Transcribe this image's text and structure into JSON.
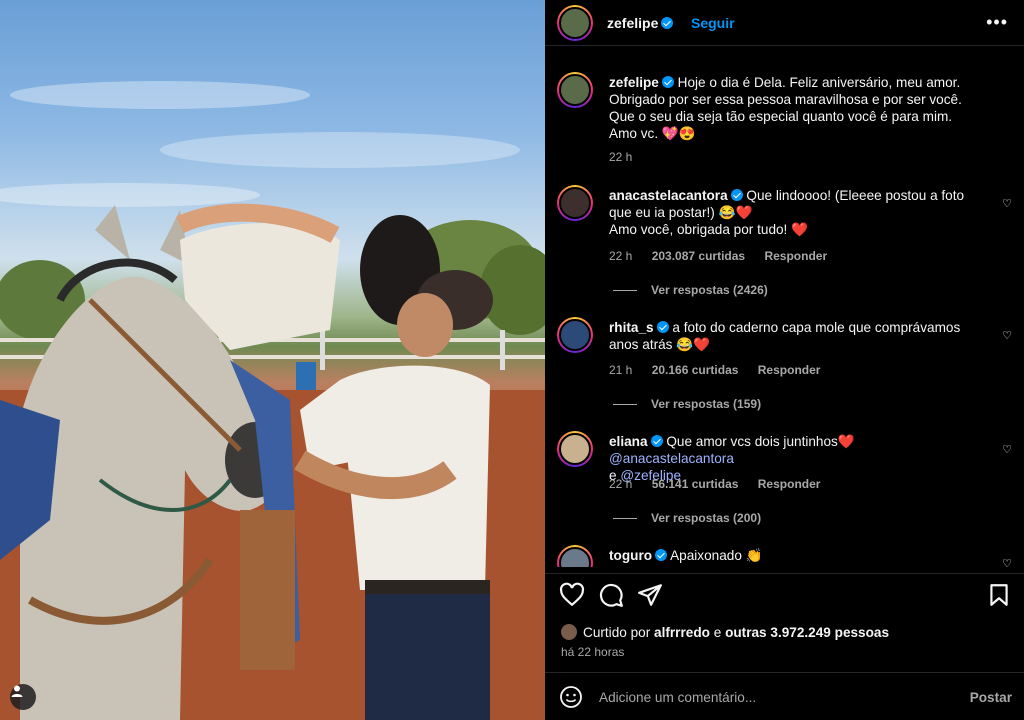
{
  "post": {
    "author": "zefelipe",
    "follow_label": "Seguir",
    "more_label": "•••"
  },
  "caption": {
    "username": "zefelipe",
    "text": "Hoje o dia é Dela. Feliz aniversário, meu amor. Obrigado por ser essa pessoa maravilhosa e por ser você. Que o seu dia seja tão especial quanto você é para mim.",
    "text2": "Amo vc. 💖😍",
    "time": "22 h"
  },
  "comments": [
    {
      "username": "anacastelacantora",
      "verified": true,
      "text": "Que lindoooo! (Eleeee postou a foto que eu ia postar!) 😂❤️",
      "text2": "Amo você, obrigada por tudo! ❤️",
      "time": "22 h",
      "likes": "203.087 curtidas",
      "reply_label": "Responder",
      "view_replies": "Ver respostas (2426)"
    },
    {
      "username": "rhita_s",
      "verified": true,
      "text": "a foto do caderno capa mole que comprávamos anos atrás 😂❤️",
      "time": "21 h",
      "likes": "20.166 curtidas",
      "reply_label": "Responder",
      "view_replies": "Ver respostas (159)"
    },
    {
      "username": "eliana",
      "verified": true,
      "text": "Que amor vcs dois juntinhos❤️",
      "mention1": "@anacastelacantora",
      "conj": "e",
      "mention2": "@zefelipe",
      "time": "22 h",
      "likes": "56.141 curtidas",
      "reply_label": "Responder",
      "view_replies": "Ver respostas (200)"
    },
    {
      "username": "toguro",
      "verified": true,
      "text": "Apaixonado 👏"
    }
  ],
  "likes_line": {
    "prefix": "Curtido por",
    "user": "alfrrredo",
    "conj": "e",
    "others": "outras 3.972.249 pessoas"
  },
  "posted_ago": "há 22 horas",
  "add_comment": {
    "placeholder": "Adicione um comentário...",
    "post_label": "Postar"
  },
  "icons": [
    "heart-icon",
    "comment-icon",
    "share-icon",
    "bookmark-icon",
    "emoji-icon",
    "user-icon",
    "verified-icon"
  ],
  "colors": {
    "accent": "#0095f6",
    "background": "#000000",
    "muted": "#a8a8a8",
    "mention": "#a0b4ff"
  }
}
